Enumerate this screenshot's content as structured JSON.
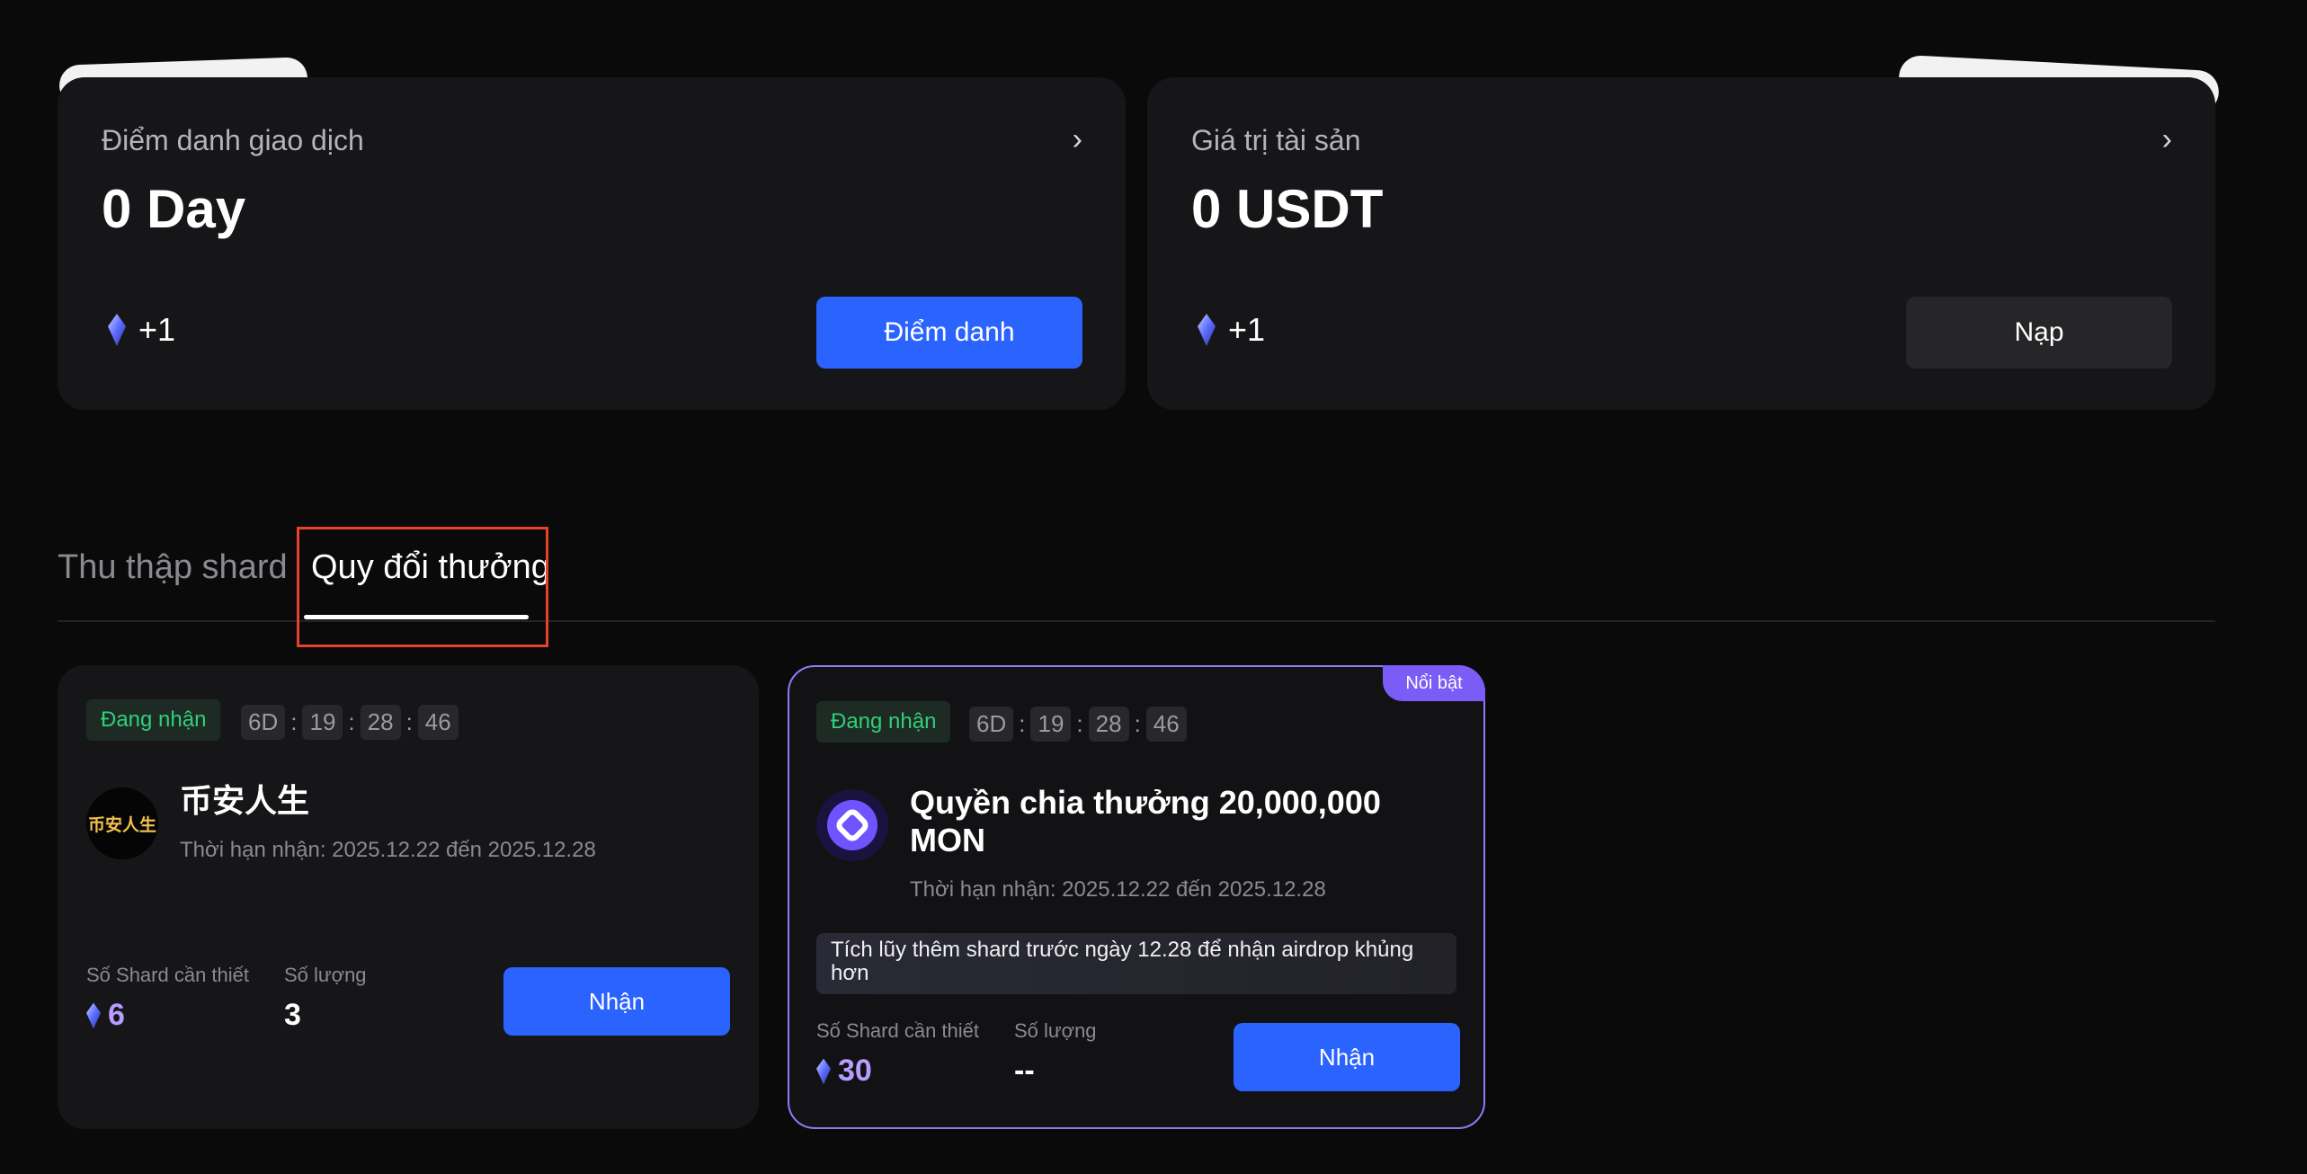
{
  "stats": [
    {
      "label": "Điểm danh giao dịch",
      "value": "0 Day",
      "reward": "+1",
      "button": "Điểm danh",
      "button_style": "primary"
    },
    {
      "label": "Giá trị tài sản",
      "value": "0 USDT",
      "reward": "+1",
      "button": "Nạp",
      "button_style": "secondary"
    }
  ],
  "chevron": "›",
  "tabs": {
    "inactive": "Thu thập shard",
    "active": "Quy đổi thưởng"
  },
  "rewards": [
    {
      "status": "Đang nhận",
      "timer": [
        "6D",
        "19",
        "28",
        "46"
      ],
      "logo_text": "币安人生",
      "title": "币安人生",
      "period": "Thời hạn nhận: 2025.12.22 đến 2025.12.28",
      "shard_label": "Số Shard cần thiết",
      "shard_value": "6",
      "qty_label": "Số lượng",
      "qty_value": "3",
      "button": "Nhận"
    },
    {
      "badge": "Nổi bật",
      "status": "Đang nhận",
      "timer": [
        "6D",
        "19",
        "28",
        "46"
      ],
      "title_line1": "Quyền chia thưởng 20,000,000",
      "title_line2": "MON",
      "period": "Thời hạn nhận: 2025.12.22 đến 2025.12.28",
      "promo": "Tích lũy thêm shard trước ngày 12.28 để nhận airdrop khủng hơn",
      "shard_label": "Số Shard cần thiết",
      "shard_value": "30",
      "qty_label": "Số lượng",
      "qty_value": "--",
      "button": "Nhận"
    }
  ],
  "colors": {
    "accent": "#2b63ff",
    "status_green": "#2fd07a",
    "featured_purple": "#7b5cf6",
    "tab_highlight": "#e8412c"
  }
}
